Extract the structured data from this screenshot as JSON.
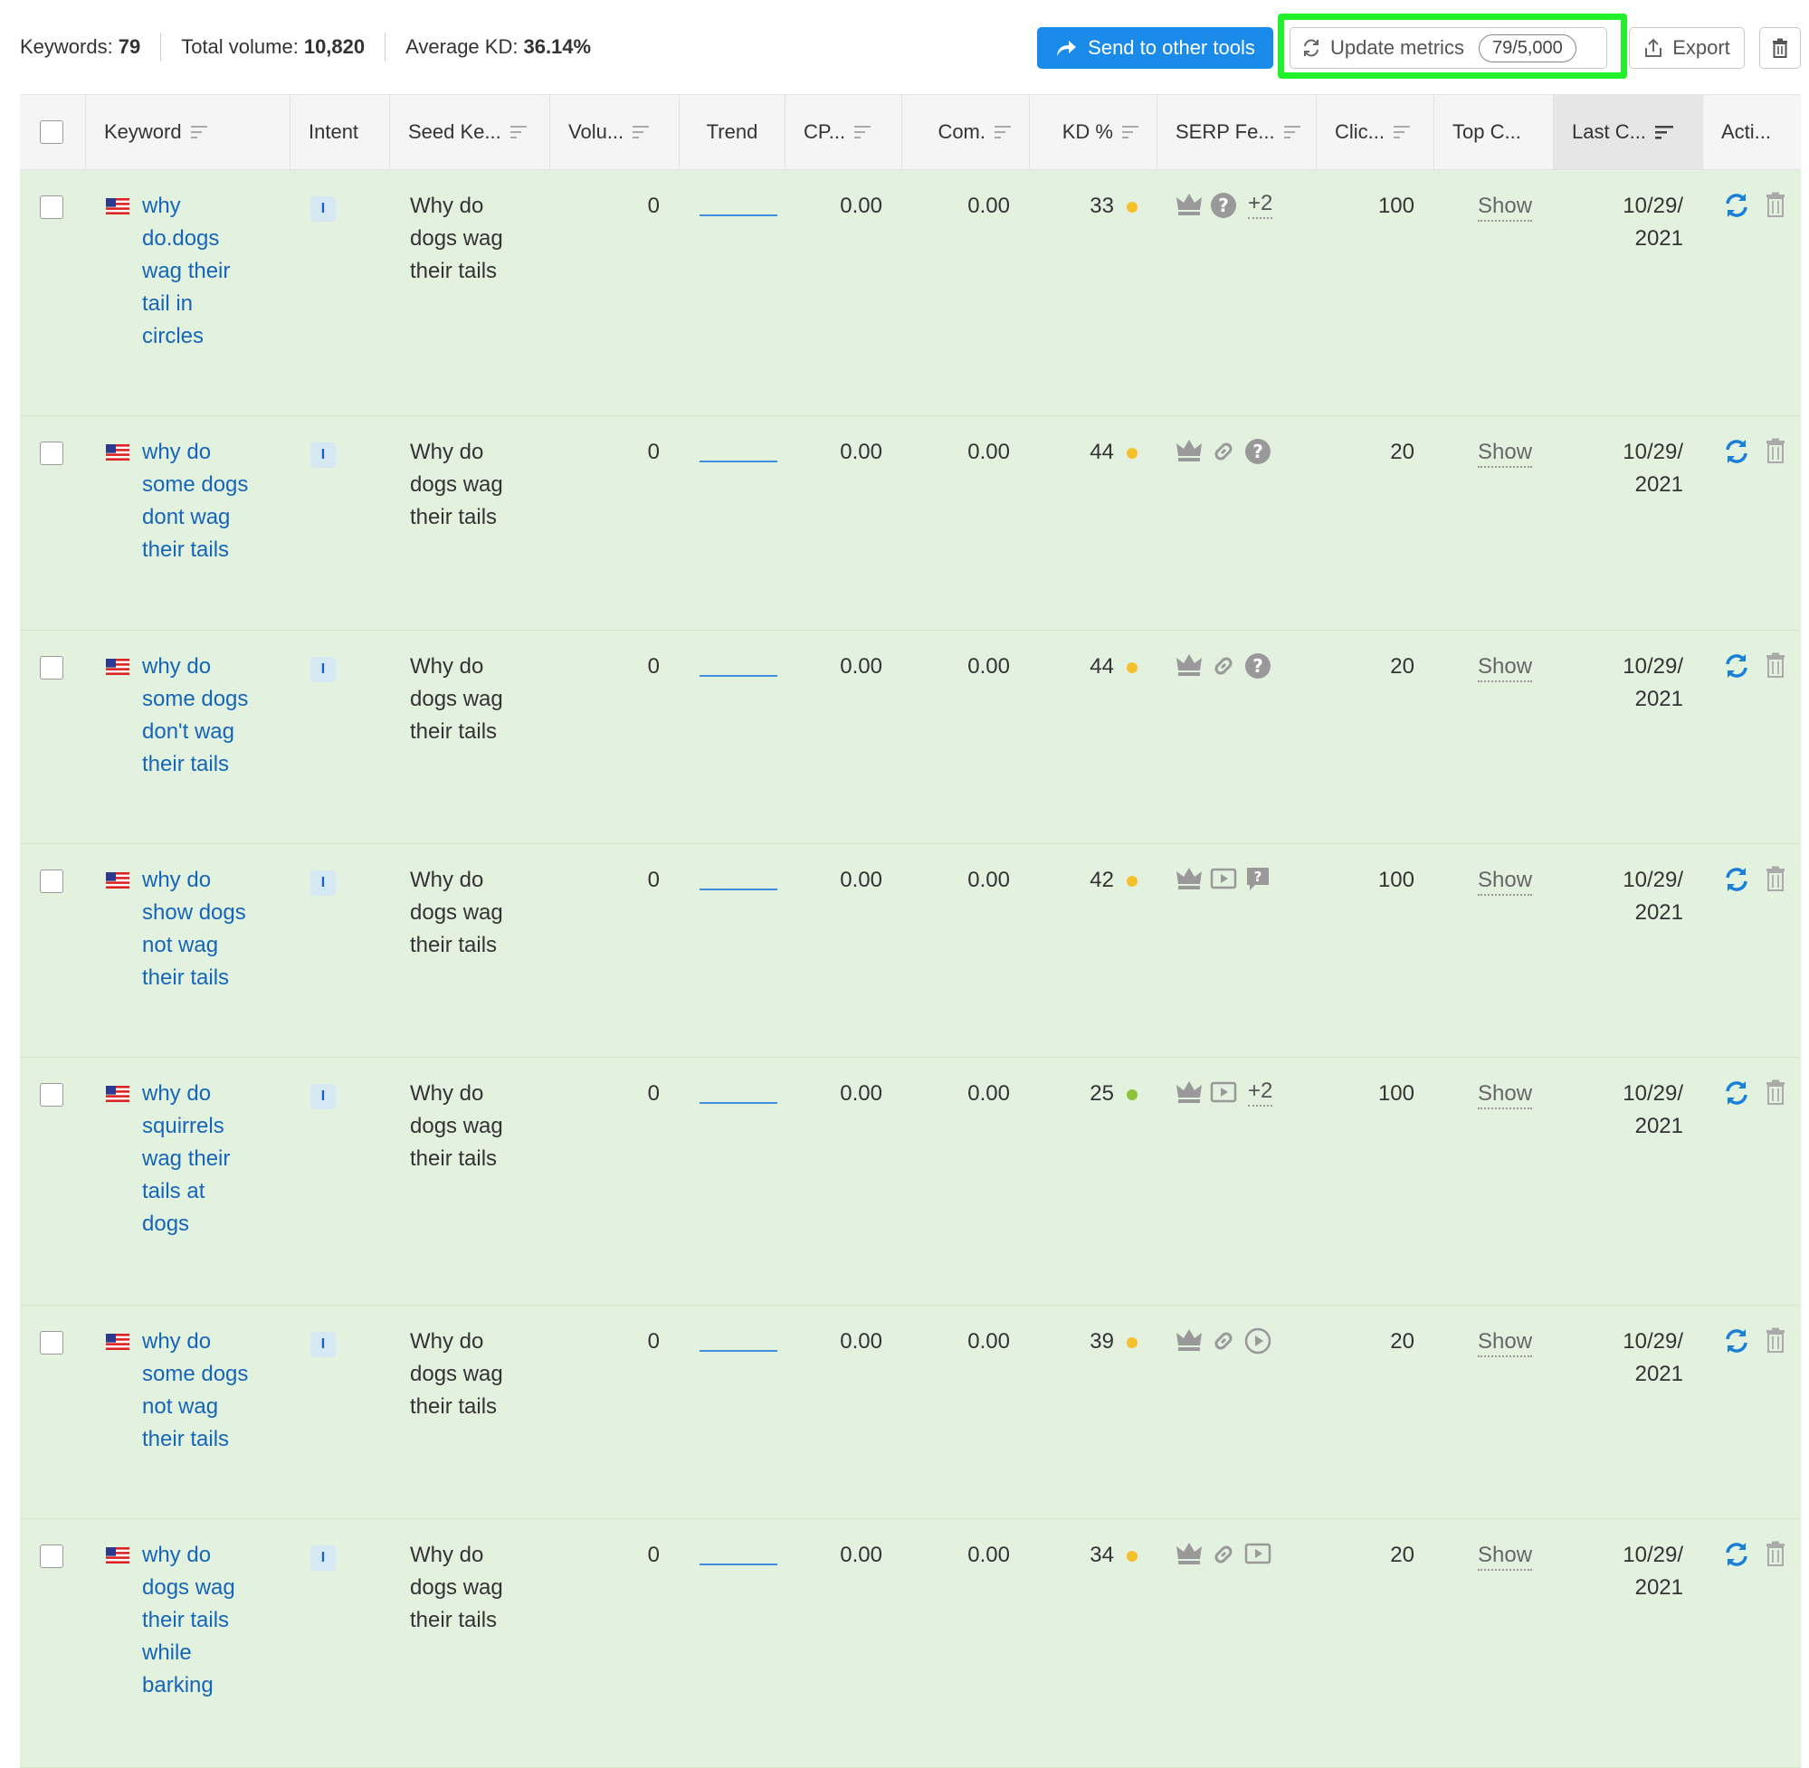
{
  "stats": {
    "keywords_label": "Keywords:",
    "keywords_value": "79",
    "volume_label": "Total volume:",
    "volume_value": "10,820",
    "kd_label": "Average KD:",
    "kd_value": "36.14%"
  },
  "toolbar": {
    "send_label": "Send to other tools",
    "update_label": "Update metrics",
    "update_count": "79/5,000",
    "export_label": "Export"
  },
  "colors": {
    "accent": "#1a8be8",
    "link": "#1565b8",
    "row_bg": "#e3f2de",
    "highlight": "#22f02b",
    "kd_yellow": "#f6c02c",
    "kd_green": "#8ac43b"
  },
  "columns": {
    "keyword": "Keyword",
    "intent": "Intent",
    "seed": "Seed Ke...",
    "volume": "Volu...",
    "trend": "Trend",
    "cpc": "CP...",
    "com": "Com.",
    "kd": "KD %",
    "serp": "SERP Fe...",
    "clicks": "Clic...",
    "top": "Top C...",
    "last": "Last C...",
    "actions": "Acti..."
  },
  "rows": [
    {
      "keyword_lines": [
        "why",
        "do.dogs",
        "wag their",
        "tail in",
        "circles"
      ],
      "intent": "I",
      "seed_lines": [
        "Why do",
        "dogs wag",
        "their tails"
      ],
      "volume": "0",
      "cpc": "0.00",
      "com": "0.00",
      "kd": "33",
      "kd_color": "yellow",
      "serp_icons": [
        "crown-icon",
        "question-icon"
      ],
      "serp_more": "+2",
      "clicks": "100",
      "top": "Show",
      "date_lines": [
        "10/29/",
        "2021"
      ]
    },
    {
      "keyword_lines": [
        "why do",
        "some dogs",
        "dont wag",
        "their tails"
      ],
      "intent": "I",
      "seed_lines": [
        "Why do",
        "dogs wag",
        "their tails"
      ],
      "volume": "0",
      "cpc": "0.00",
      "com": "0.00",
      "kd": "44",
      "kd_color": "yellow",
      "serp_icons": [
        "crown-icon",
        "link-icon",
        "question-icon"
      ],
      "serp_more": "",
      "clicks": "20",
      "top": "Show",
      "date_lines": [
        "10/29/",
        "2021"
      ]
    },
    {
      "keyword_lines": [
        "why do",
        "some dogs",
        "don't wag",
        "their tails"
      ],
      "intent": "I",
      "seed_lines": [
        "Why do",
        "dogs wag",
        "their tails"
      ],
      "volume": "0",
      "cpc": "0.00",
      "com": "0.00",
      "kd": "44",
      "kd_color": "yellow",
      "serp_icons": [
        "crown-icon",
        "link-icon",
        "question-icon"
      ],
      "serp_more": "",
      "clicks": "20",
      "top": "Show",
      "date_lines": [
        "10/29/",
        "2021"
      ]
    },
    {
      "keyword_lines": [
        "why do",
        "show dogs",
        "not wag",
        "their tails"
      ],
      "intent": "I",
      "seed_lines": [
        "Why do",
        "dogs wag",
        "their tails"
      ],
      "volume": "0",
      "cpc": "0.00",
      "com": "0.00",
      "kd": "42",
      "kd_color": "yellow",
      "serp_icons": [
        "crown-icon",
        "video-icon",
        "faq-icon"
      ],
      "serp_more": "",
      "clicks": "100",
      "top": "Show",
      "date_lines": [
        "10/29/",
        "2021"
      ]
    },
    {
      "keyword_lines": [
        "why do",
        "squirrels",
        "wag their",
        "tails at",
        "dogs"
      ],
      "intent": "I",
      "seed_lines": [
        "Why do",
        "dogs wag",
        "their tails"
      ],
      "volume": "0",
      "cpc": "0.00",
      "com": "0.00",
      "kd": "25",
      "kd_color": "green",
      "serp_icons": [
        "crown-icon",
        "video-icon"
      ],
      "serp_more": "+2",
      "clicks": "100",
      "top": "Show",
      "date_lines": [
        "10/29/",
        "2021"
      ]
    },
    {
      "keyword_lines": [
        "why do",
        "some dogs",
        "not wag",
        "their tails"
      ],
      "intent": "I",
      "seed_lines": [
        "Why do",
        "dogs wag",
        "their tails"
      ],
      "volume": "0",
      "cpc": "0.00",
      "com": "0.00",
      "kd": "39",
      "kd_color": "yellow",
      "serp_icons": [
        "crown-icon",
        "link-icon",
        "play-circle-icon"
      ],
      "serp_more": "",
      "clicks": "20",
      "top": "Show",
      "date_lines": [
        "10/29/",
        "2021"
      ]
    },
    {
      "keyword_lines": [
        "why do",
        "dogs wag",
        "their tails",
        "while",
        "barking"
      ],
      "intent": "I",
      "seed_lines": [
        "Why do",
        "dogs wag",
        "their tails"
      ],
      "volume": "0",
      "cpc": "0.00",
      "com": "0.00",
      "kd": "34",
      "kd_color": "yellow",
      "serp_icons": [
        "crown-icon",
        "link-icon",
        "video-icon"
      ],
      "serp_more": "",
      "clicks": "20",
      "top": "Show",
      "date_lines": [
        "10/29/",
        "2021"
      ]
    }
  ]
}
